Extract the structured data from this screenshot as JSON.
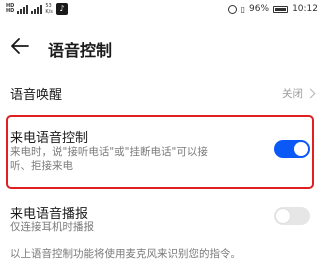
{
  "status_bar": {
    "hd_label_top": "HD",
    "hd_label_bottom": "HD",
    "net_speed_value": "53",
    "net_speed_unit": "K/s",
    "battery": "96%",
    "time": "10:12",
    "icons": [
      "signal-icon",
      "app-notification-icon",
      "alarm-icon",
      "vibrate-icon",
      "battery-icon"
    ]
  },
  "header": {
    "back_icon": "back-arrow-icon",
    "title": "语音控制"
  },
  "settings": {
    "voice_wakeup": {
      "title": "语音唤醒",
      "value": "关闭"
    },
    "incoming_call_voice": {
      "title": "来电语音控制",
      "description_line1": "来电时，说\"接听电话\"或\"挂断电话\"可以接",
      "description_line2": "听、拒接来电",
      "enabled": true
    },
    "incoming_call_broadcast": {
      "title": "来电语音播报",
      "description": "仅连接耳机时播报",
      "enabled": false
    }
  },
  "footer_note": "以上语音控制功能将使用麦克风来识别您的指令。",
  "colors": {
    "accent": "#0a59f7",
    "highlight_border": "#e02020",
    "toggle_off": "#e6e6e6"
  }
}
